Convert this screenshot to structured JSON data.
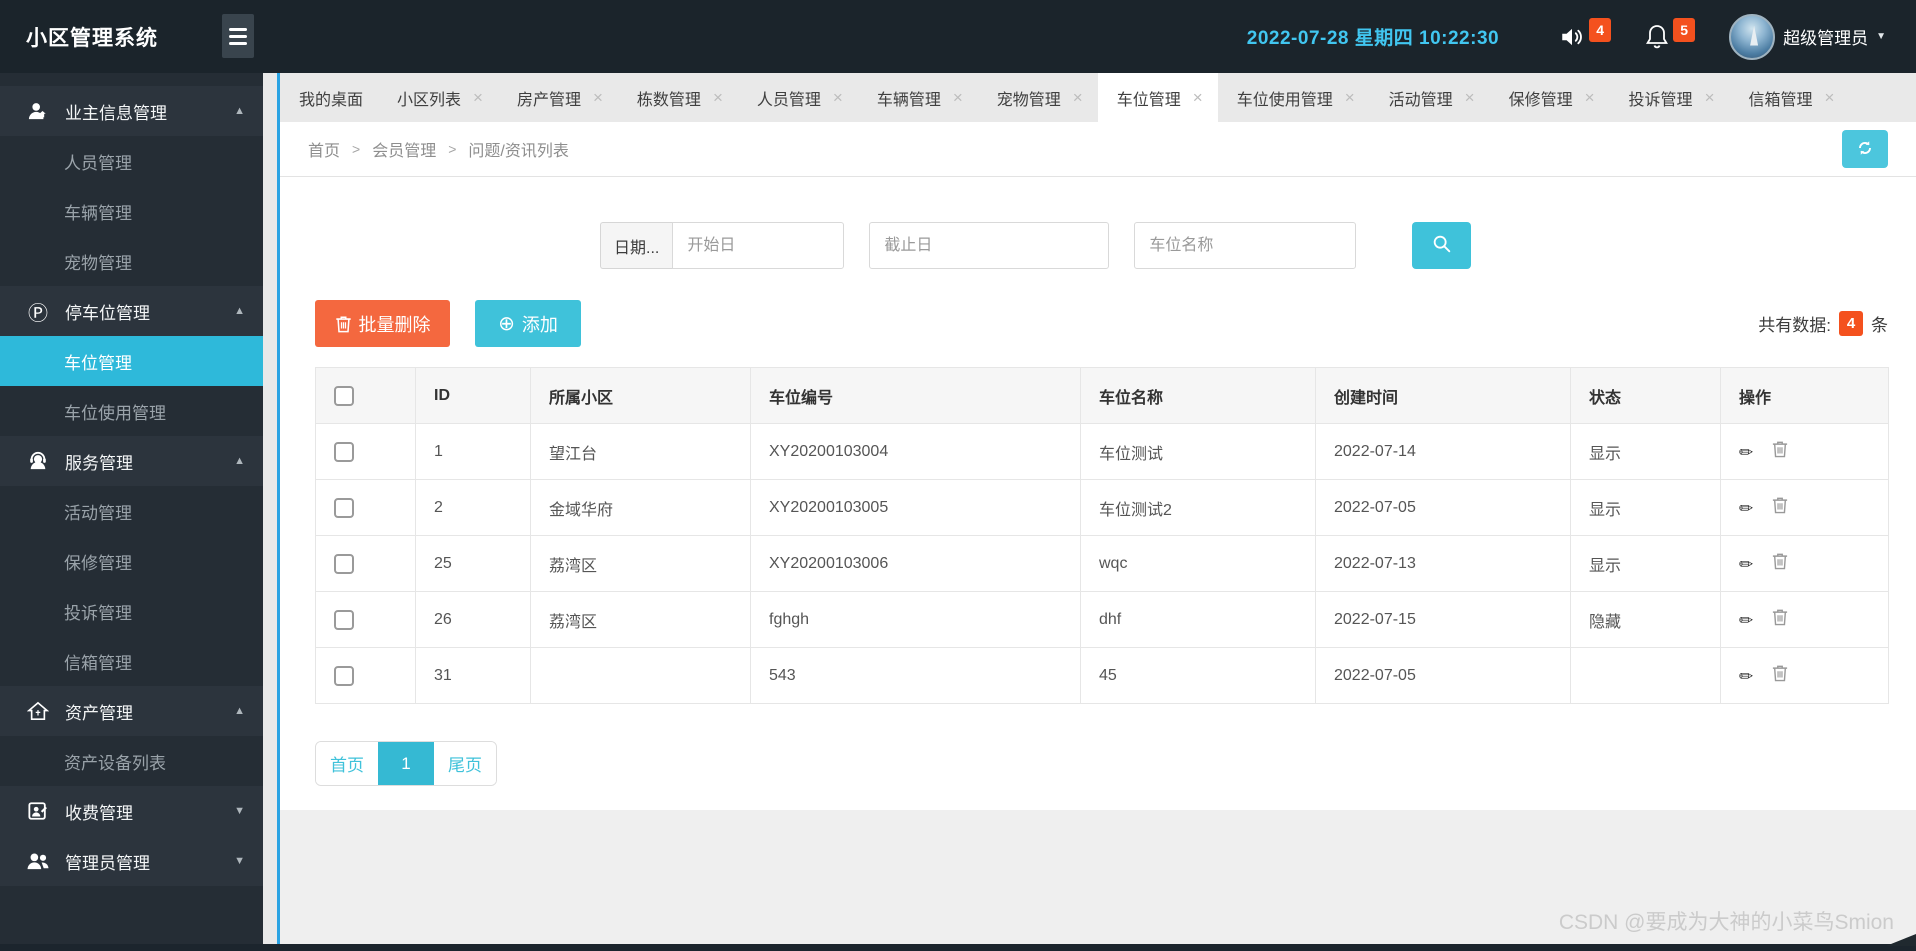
{
  "app": {
    "title": "小区管理系统"
  },
  "header": {
    "datetime": "2022-07-28  星期四  10:22:30",
    "sound_badge": "4",
    "bell_badge": "5",
    "user_role": "超级管理员"
  },
  "icons": {
    "close": "×",
    "caret_up": "▲",
    "caret_down": "▼",
    "breadcrumb_sep": ">",
    "parking": "Ⓟ",
    "pencil": "✏",
    "plus_circle": "⊕"
  },
  "sidebar": {
    "groups": [
      {
        "label": "业主信息管理",
        "icon": "owner-icon",
        "state": "expanded",
        "children": [
          "人员管理",
          "车辆管理",
          "宠物管理"
        ]
      },
      {
        "label": "停车位管理",
        "icon": "parking-icon",
        "state": "expanded",
        "children": [
          "车位管理",
          "车位使用管理"
        ],
        "active_child": "车位管理"
      },
      {
        "label": "服务管理",
        "icon": "service-icon",
        "state": "expanded",
        "children": [
          "活动管理",
          "保修管理",
          "投诉管理",
          "信箱管理"
        ]
      },
      {
        "label": "资产管理",
        "icon": "asset-icon",
        "state": "expanded",
        "children": [
          "资产设备列表"
        ]
      },
      {
        "label": "收费管理",
        "icon": "billing-icon",
        "state": "collapsed",
        "children": []
      },
      {
        "label": "管理员管理",
        "icon": "admins-icon",
        "state": "collapsed",
        "children": []
      }
    ]
  },
  "tabs": [
    {
      "label": "我的桌面",
      "closable": false,
      "active": false
    },
    {
      "label": "小区列表",
      "closable": true,
      "active": false
    },
    {
      "label": "房产管理",
      "closable": true,
      "active": false
    },
    {
      "label": "栋数管理",
      "closable": true,
      "active": false
    },
    {
      "label": "人员管理",
      "closable": true,
      "active": false
    },
    {
      "label": "车辆管理",
      "closable": true,
      "active": false
    },
    {
      "label": "宠物管理",
      "closable": true,
      "active": false
    },
    {
      "label": "车位管理",
      "closable": true,
      "active": true
    },
    {
      "label": "车位使用管理",
      "closable": true,
      "active": false
    },
    {
      "label": "活动管理",
      "closable": true,
      "active": false
    },
    {
      "label": "保修管理",
      "closable": true,
      "active": false
    },
    {
      "label": "投诉管理",
      "closable": true,
      "active": false
    },
    {
      "label": "信箱管理",
      "closable": true,
      "active": false
    }
  ],
  "breadcrumb": {
    "items": [
      "首页",
      "会员管理",
      "问题/资讯列表"
    ]
  },
  "filters": {
    "date_label": "日期...",
    "start_placeholder": "开始日",
    "end_placeholder": "截止日",
    "name_placeholder": "车位名称"
  },
  "toolbar": {
    "batch_delete_label": "批量删除",
    "add_label": "添加",
    "total_prefix": "共有数据:",
    "total_count": "4",
    "total_suffix": "条"
  },
  "table": {
    "headers": [
      "ID",
      "所属小区",
      "车位编号",
      "车位名称",
      "创建时间",
      "状态",
      "操作"
    ],
    "rows": [
      {
        "id": "1",
        "community": "望江台",
        "code": "XY20200103004",
        "name": "车位测试",
        "created": "2022-07-14",
        "status": "显示"
      },
      {
        "id": "2",
        "community": "金域华府",
        "code": "XY20200103005",
        "name": "车位测试2",
        "created": "2022-07-05",
        "status": "显示"
      },
      {
        "id": "25",
        "community": "荔湾区",
        "code": "XY20200103006",
        "name": "wqc",
        "created": "2022-07-13",
        "status": "显示"
      },
      {
        "id": "26",
        "community": "荔湾区",
        "code": "fghgh",
        "name": "dhf",
        "created": "2022-07-15",
        "status": "隐藏"
      },
      {
        "id": "31",
        "community": "",
        "code": "543",
        "name": "45",
        "created": "2022-07-05",
        "status": ""
      }
    ]
  },
  "pagination": {
    "first": "首页",
    "current": "1",
    "last": "尾页"
  },
  "watermark": "CSDN @要成为大神的小菜鸟Smion",
  "colors": {
    "header_bg": "#1b242b",
    "sidebar_bg": "#252d35",
    "sidebar_parent_bg": "#2c343d",
    "active_item": "#2eb9da",
    "accent_cyan": "#3fc2da",
    "danger_orange": "#f4683f",
    "badge_red": "#f4511e",
    "status_green": "#3ce53c",
    "datetime_cyan": "#41c6f0",
    "blue_edge": "#2aa3e3"
  }
}
